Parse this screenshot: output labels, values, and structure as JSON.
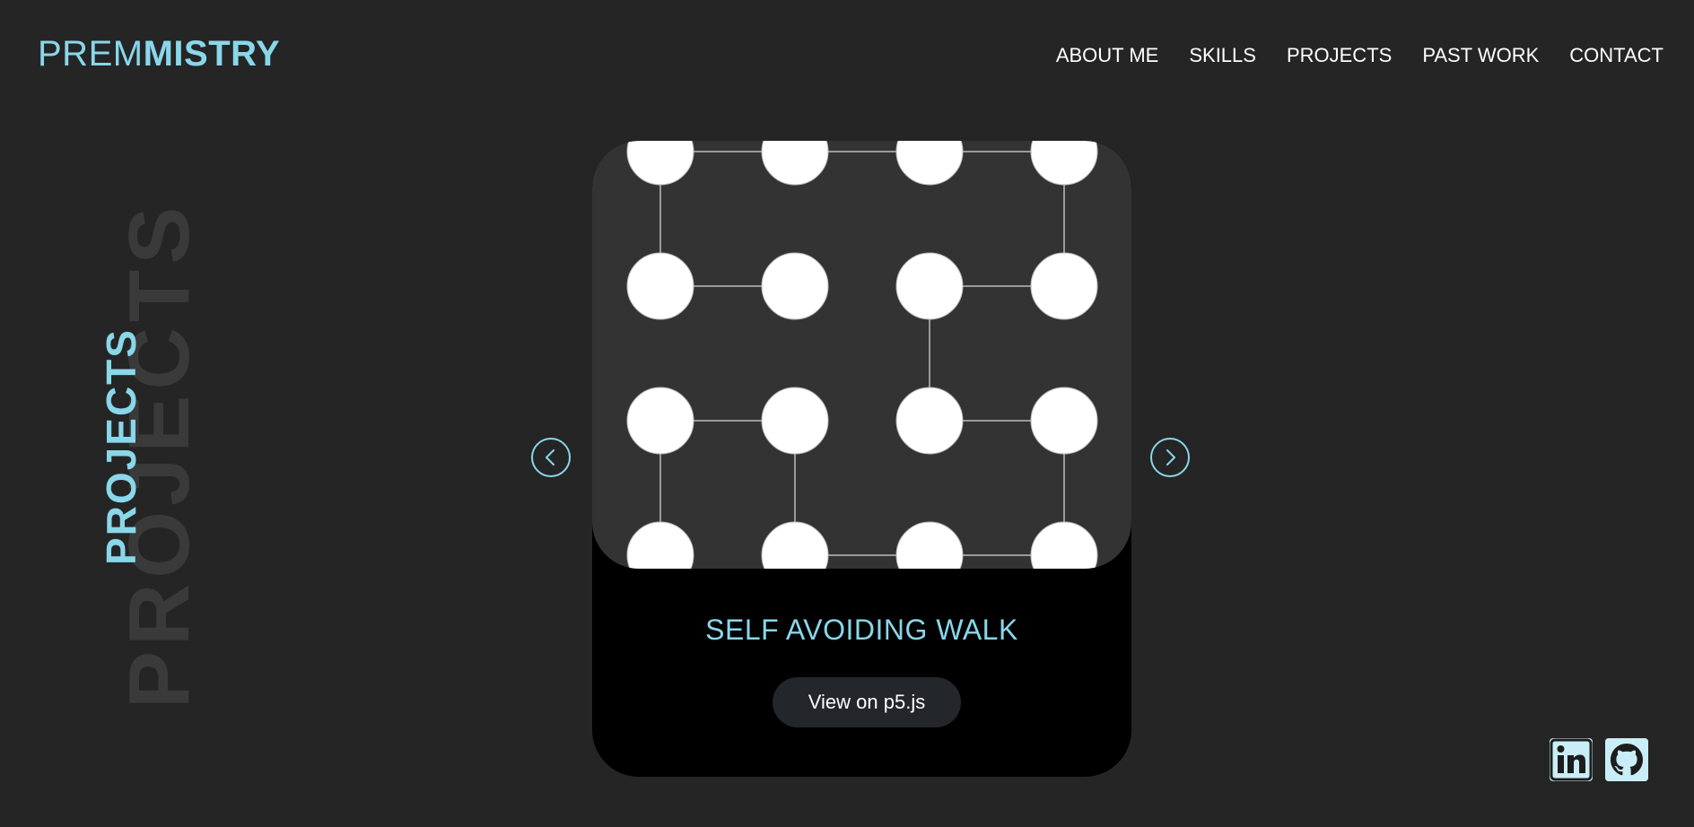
{
  "header": {
    "logo_light": "PREM",
    "logo_bold": "MISTRY",
    "nav": [
      {
        "label": "ABOUT ME"
      },
      {
        "label": "SKILLS"
      },
      {
        "label": "PROJECTS"
      },
      {
        "label": "PAST WORK"
      },
      {
        "label": "CONTACT"
      }
    ]
  },
  "section": {
    "ghost_title": "PROJECTS",
    "title": "PROJECTS"
  },
  "project": {
    "title": "SELF AVOIDING WALK",
    "button_label": "View on p5.js",
    "image": "self-avoiding-walk-grid"
  },
  "carousel": {
    "prev_icon": "chevron-left-icon",
    "next_icon": "chevron-right-icon"
  },
  "social": [
    {
      "icon": "linkedin-icon"
    },
    {
      "icon": "github-icon"
    }
  ],
  "colors": {
    "background": "#252525",
    "accent": "#89d7ea",
    "card": "#000000",
    "card_image_bg": "#333333",
    "button_bg": "#23262b"
  }
}
